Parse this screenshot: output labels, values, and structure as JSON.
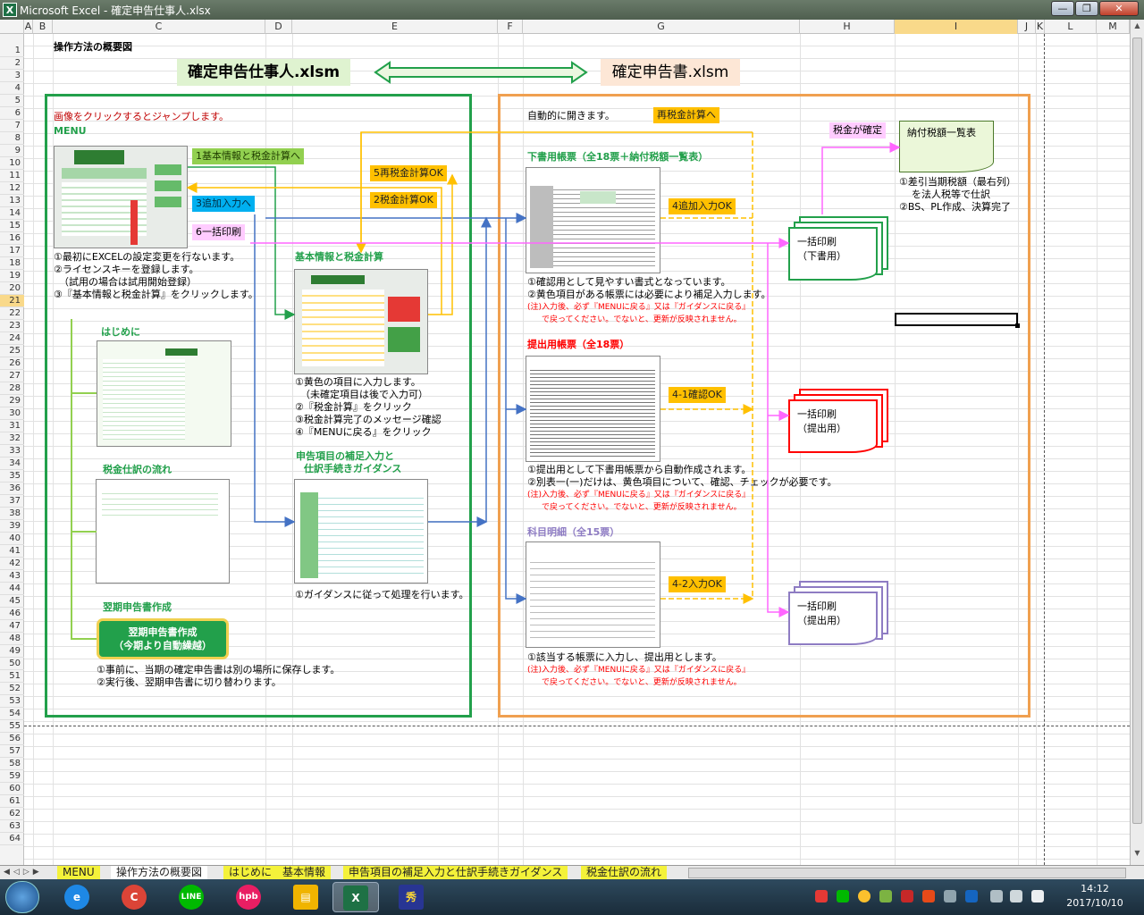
{
  "window": {
    "title": "Microsoft Excel - 確定申告仕事人.xlsx",
    "buttons": {
      "minimize": "—",
      "restore": "❐",
      "close": "✕"
    }
  },
  "columns": [
    "A",
    "B",
    "C",
    "D",
    "E",
    "F",
    "G",
    "H",
    "I",
    "J",
    "K",
    "L",
    "M"
  ],
  "selected_cell": "I21",
  "rows": [
    "1",
    "2",
    "3",
    "4",
    "5",
    "6",
    "7",
    "8",
    "9",
    "10",
    "11",
    "12",
    "13",
    "14",
    "15",
    "16",
    "17",
    "18",
    "19",
    "20",
    "21",
    "22",
    "23",
    "24",
    "25",
    "26",
    "27",
    "28",
    "29",
    "30",
    "31",
    "32",
    "33",
    "34",
    "35",
    "36",
    "37",
    "38",
    "39",
    "40",
    "41",
    "42",
    "43",
    "44",
    "45",
    "46",
    "47",
    "48",
    "49",
    "50",
    "51",
    "52",
    "53",
    "54",
    "55",
    "56",
    "57",
    "58",
    "59",
    "60",
    "61",
    "62",
    "63",
    "64"
  ],
  "sheet": {
    "heading": "操作方法の概要図",
    "file_left": "確定申告仕事人.xlsm",
    "file_right": "確定申告書.xlsm",
    "left_panel": {
      "jump_note": "画像をクリックするとジャンプします。",
      "menu_label": "MENU",
      "btn1": "1基本情報と税金計算へ",
      "btn3": "3追加入力へ",
      "btn6": "6一括印刷",
      "btn5": "5再税金計算OK",
      "btn2": "2税金計算OK",
      "menu_notes": [
        "①最初にEXCELの設定変更を行ないます。",
        "②ライセンスキーを登録します。",
        "（試用の場合は試用開始登録）",
        "③『基本情報と税金計算』をクリックします。"
      ],
      "kihon_title": "基本情報と税金計算",
      "kihon_notes": [
        "①黄色の項目に入力します。",
        "（未確定項目は後で入力可）",
        "②『税金計算』をクリック",
        "③税金計算完了のメッセージ確認",
        "④『MENUに戻る』をクリック"
      ],
      "hajimeni_title": "はじめに",
      "zeikin_title": "税金仕訳の流れ",
      "hosoku_title_1": "申告項目の補足入力と",
      "hosoku_title_2": "仕訳手続きガイダンス",
      "hosoku_note": "①ガイダンスに従って処理を行います。",
      "yokki_title": "翌期申告書作成",
      "yokki_btn_1": "翌期申告書作成",
      "yokki_btn_2": "（今期より自動繰越）",
      "yokki_notes": [
        "①事前に、当期の確定申告書は別の場所に保存します。",
        "②実行後、翌期申告書に切り替わります。"
      ]
    },
    "right_panel": {
      "auto_open": "自動的に開きます。",
      "resaikeisan": "再税金計算へ",
      "zeikin_kakutei": "税金が確定",
      "nofu_list": "納付税額一覧表",
      "nofu_notes": [
        "①差引当期税額（最右列）",
        "を法人税等で仕訳",
        "②BS、PL作成、決算完了"
      ],
      "shitagaki_title": "下書用帳票（全18票＋納付税額一覧表）",
      "btn4": "4追加入力OK",
      "print1": [
        "一括印刷",
        "（下書用）"
      ],
      "shitagaki_notes": [
        "①確認用として見やすい書式となっています。",
        "②黄色項目がある帳票には必要により補足入力します。"
      ],
      "caution_1": "(注)入力後、必ず『MENUに戻る』又は『ガイダンスに戻る』",
      "caution_2": "で戻ってください。でないと、更新が反映されません。",
      "teishutsu_title": "提出用帳票（全18票）",
      "btn41": "4-1確認OK",
      "print2": [
        "一括印刷",
        "（提出用）"
      ],
      "teishutsu_notes": [
        "①提出用として下書用帳票から自動作成されます。",
        "②別表一(一)だけは、黄色項目について、確認、チェックが必要です。"
      ],
      "kamoku_title": "科目明細（全15票）",
      "btn42": "4-2入力OK",
      "print3": [
        "一括印刷",
        "（提出用）"
      ],
      "kamoku_note": "①該当する帳票に入力し、提出用とします。"
    }
  },
  "tabs": [
    "MENU",
    "操作方法の概要図",
    "はじめに",
    "基本情報",
    "申告項目の補足入力と仕訳手続きガイダンス",
    "税金仕訳の流れ"
  ],
  "active_tab": "操作方法の概要図",
  "taskbar": {
    "apps": [
      "e",
      "C",
      "LINE",
      "hpb",
      "▤",
      "X",
      "秀"
    ],
    "time": "14:12",
    "date": "2017/10/10"
  },
  "colors": {
    "green_frame": "#22a04b",
    "orange_frame": "#f0a050",
    "button_yellow": "#ffc000",
    "button_green": "#92d050",
    "button_cyan": "#00b0f0",
    "button_pink": "#ffccff",
    "arrow_blue": "#4472c4",
    "arrow_pink": "#ff66ff",
    "arrow_orange": "#ffc000",
    "caution_red": "#ff0000"
  }
}
